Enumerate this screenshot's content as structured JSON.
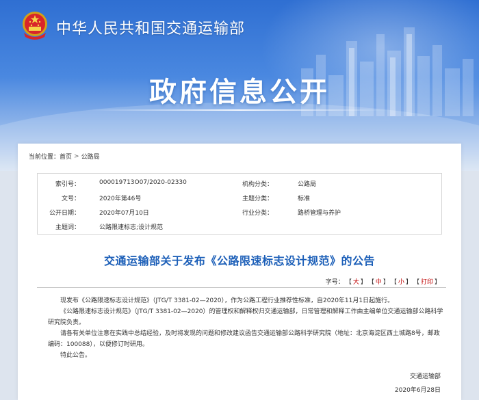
{
  "header": {
    "ministry_name": "中华人民共和国交通运输部",
    "banner_title": "政府信息公开"
  },
  "breadcrumb": {
    "label": "当前位置：",
    "items": [
      "首页",
      "公路局"
    ],
    "separator": ">"
  },
  "meta": {
    "rows": [
      {
        "label1": "索引号：",
        "value1": "000019713O07/2020-02330",
        "label2": "机构分类：",
        "value2": "公路局"
      },
      {
        "label1": "文号：",
        "value1": "2020年第46号",
        "label2": "主题分类：",
        "value2": "标准"
      },
      {
        "label1": "公开日期：",
        "value1": "2020年07月10日",
        "label2": "行业分类：",
        "value2": "路桥管理与养护"
      },
      {
        "label1": "主题词：",
        "value1": "公路限速标志;设计规范",
        "label2": "",
        "value2": ""
      }
    ]
  },
  "article": {
    "title": "交通运输部关于发布《公路限速标志设计规范》的公告",
    "font_size_label": "字号：",
    "font_sizes": [
      "大",
      "中",
      "小"
    ],
    "print_label": "打印",
    "paragraphs": [
      "现发布《公路限速标志设计规范》（JTG/T 3381-02—2020），作为公路工程行业推荐性标准，自2020年11月1日起施行。",
      "《公路限速标志设计规范》（JTG/T 3381-02—2020）的管理权和解释权归交通运输部，日常管理和解释工作由主编单位交通运输部公路科学研究院负责。",
      "请各有关单位注意在实践中总结经验，及时将发现的问题和修改建议函告交通运输部公路科学研究院（地址：北京海淀区西土城路8号，邮政编码：100088），以便修订时研用。",
      "特此公告。"
    ],
    "signature": "交通运输部",
    "date": "2020年6月28日"
  },
  "colors": {
    "banner_blue": "#2f6fd2",
    "title_blue": "#1c5fb8",
    "fontsize_red": "#c00000"
  }
}
